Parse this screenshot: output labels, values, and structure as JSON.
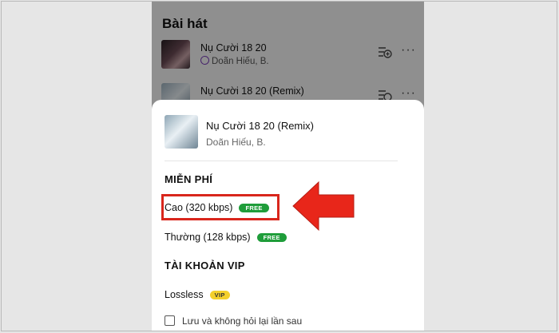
{
  "background_list": {
    "section_title": "Bài hát",
    "songs": [
      {
        "title": "Nụ Cười 18 20",
        "artist": "Doãn Hiếu, B."
      },
      {
        "title": "Nụ Cười 18 20 (Remix)",
        "artist": "Doãn Hiếu, B."
      }
    ],
    "more_glyph": "···"
  },
  "sheet": {
    "song_title": "Nụ Cười 18 20 (Remix)",
    "song_artist": "Doãn Hiếu, B.",
    "free_group": "MIỄN PHÍ",
    "free_options": [
      {
        "label": "Cao (320 kbps)",
        "badge": "FREE",
        "selected": true
      },
      {
        "label": "Thường (128 kbps)",
        "badge": "FREE",
        "selected": false
      }
    ],
    "vip_group": "TÀI KHOẢN VIP",
    "vip_options": [
      {
        "label": "Lossless",
        "badge": "VIP"
      }
    ],
    "remember_label": "Lưu và không hỏi lại lần sau",
    "remember_checked": false
  },
  "colors": {
    "free_badge": "#1f9d3a",
    "vip_badge": "#f4d02c",
    "highlight": "#d9261c"
  },
  "icons": [
    "download-icon",
    "add-to-queue-icon",
    "more-icon",
    "red-arrow-annotation",
    "checkbox-icon"
  ]
}
